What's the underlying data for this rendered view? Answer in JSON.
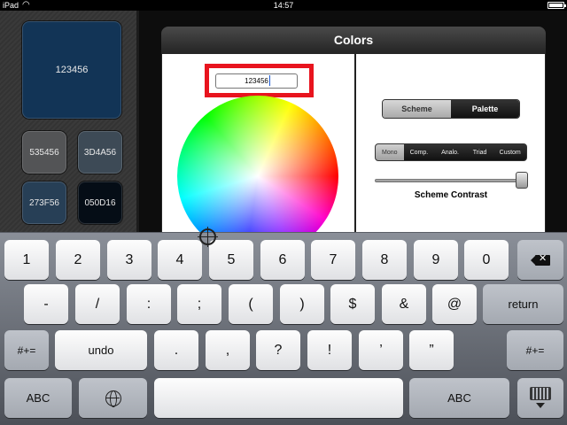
{
  "status_bar": {
    "carrier": "iPad",
    "time": "14:57"
  },
  "swatches": {
    "main": {
      "label": "123456",
      "color": "#123456"
    },
    "items": [
      {
        "label": "535456",
        "color": "#535456"
      },
      {
        "label": "3D4A56",
        "color": "#3D4A56"
      },
      {
        "label": "273F56",
        "color": "#273F56"
      },
      {
        "label": "050D16",
        "color": "#050D16"
      }
    ]
  },
  "popover": {
    "title": "Colors",
    "hex_input_value": "123456",
    "mode_segments": {
      "scheme": "Scheme",
      "palette": "Palette",
      "selected": "Palette"
    },
    "scheme_types": {
      "items": [
        "Mono",
        "Comp.",
        "Analo.",
        "Triad",
        "Custom"
      ],
      "selected": "Mono"
    },
    "slider": {
      "label": "Scheme Contrast",
      "value": 1.0
    },
    "highlight_color": "#e8141e"
  },
  "keyboard": {
    "row1": [
      "1",
      "2",
      "3",
      "4",
      "5",
      "6",
      "7",
      "8",
      "9",
      "0"
    ],
    "row2": [
      "-",
      "/",
      ":",
      ";",
      "(",
      ")",
      "$",
      "&",
      "@"
    ],
    "return_label": "return",
    "row3": {
      "shift_left": "#+=",
      "undo": "undo",
      "keys": [
        ".",
        ",",
        "?",
        "!",
        "’",
        "”"
      ],
      "shift_right": "#+="
    },
    "row4": {
      "abc_left": "ABC",
      "abc_right": "ABC"
    }
  }
}
